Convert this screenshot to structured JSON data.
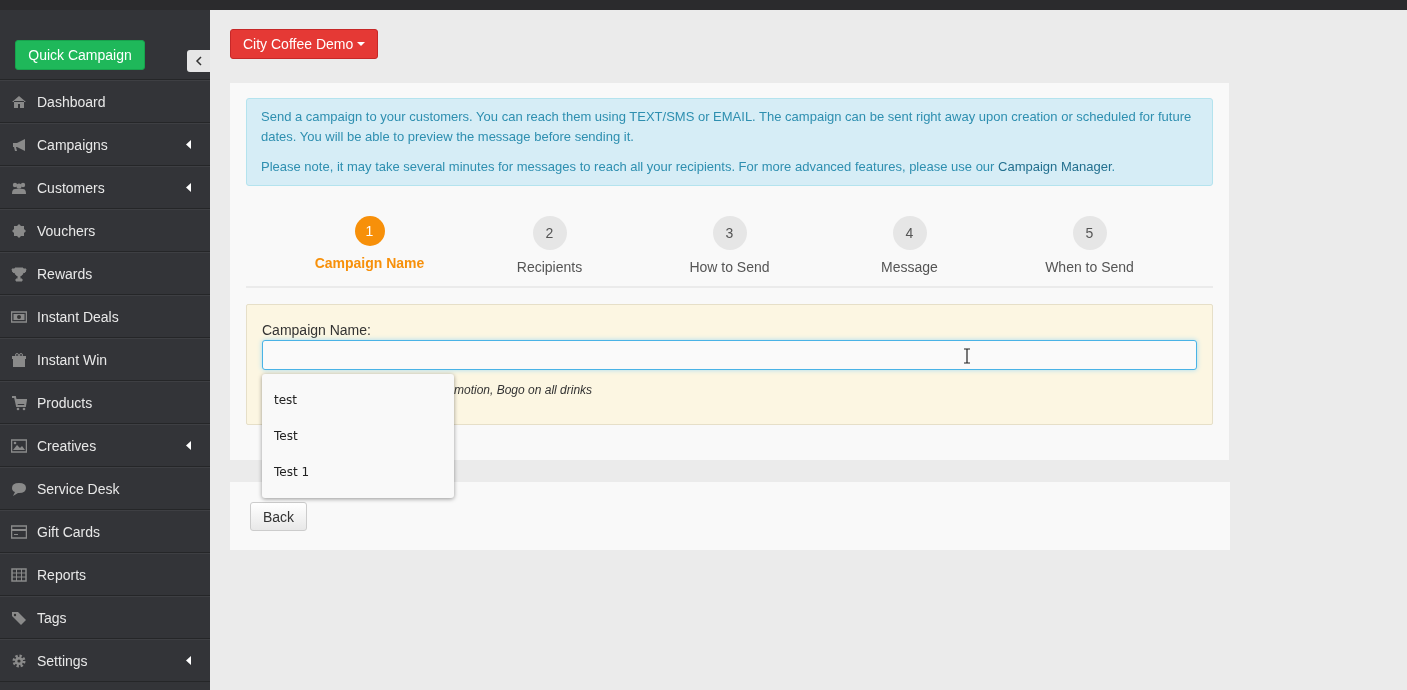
{
  "sidebar": {
    "quick_button": "Quick Campaign",
    "items": [
      {
        "label": "Dashboard",
        "has_submenu": false
      },
      {
        "label": "Campaigns",
        "has_submenu": true
      },
      {
        "label": "Customers",
        "has_submenu": true
      },
      {
        "label": "Vouchers",
        "has_submenu": false
      },
      {
        "label": "Rewards",
        "has_submenu": false
      },
      {
        "label": "Instant Deals",
        "has_submenu": false
      },
      {
        "label": "Instant Win",
        "has_submenu": false
      },
      {
        "label": "Products",
        "has_submenu": false
      },
      {
        "label": "Creatives",
        "has_submenu": true
      },
      {
        "label": "Service Desk",
        "has_submenu": false
      },
      {
        "label": "Gift Cards",
        "has_submenu": false
      },
      {
        "label": "Reports",
        "has_submenu": false
      },
      {
        "label": "Tags",
        "has_submenu": false
      },
      {
        "label": "Settings",
        "has_submenu": true
      }
    ]
  },
  "account_menu": "City Coffee Demo",
  "info": {
    "paragraph_1": "Send a campaign to your customers. You can reach them using TEXT/SMS or EMAIL. The campaign can be sent right away upon creation or scheduled for future dates. You will be able to preview the message before sending it.",
    "paragraph_2": "Please note, it may take several minutes for messages to reach all your recipients. For more advanced features, please use our ",
    "link": "Campaign Manager",
    "paragraph_2_end": "."
  },
  "steps": [
    {
      "number": "1",
      "label": "Campaign Name",
      "selected": true
    },
    {
      "number": "2",
      "label": "Recipients",
      "selected": false
    },
    {
      "number": "3",
      "label": "How to Send",
      "selected": false
    },
    {
      "number": "4",
      "label": "Message",
      "selected": false
    },
    {
      "number": "5",
      "label": "When to Send",
      "selected": false
    }
  ],
  "form": {
    "label": "Campaign Name:",
    "hint_visible": "motion, Bogo on all drinks",
    "suggestions": [
      "test",
      "Test",
      "Test 1"
    ]
  },
  "buttons": {
    "back": "Back"
  }
}
